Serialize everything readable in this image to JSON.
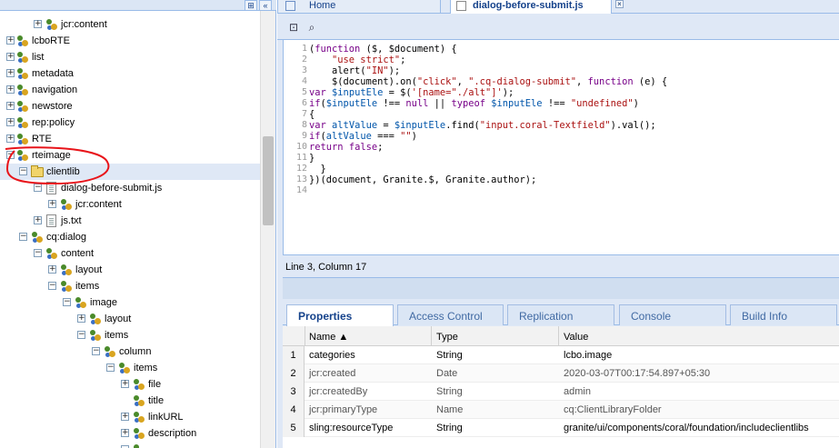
{
  "tree": {
    "nodes": [
      {
        "label": "jcr:content",
        "icon": "node-icon",
        "expander": "+"
      },
      {
        "label": "lcboRTE",
        "icon": "node-icon",
        "expander": "+"
      },
      {
        "label": "list",
        "icon": "node-icon",
        "expander": "+"
      },
      {
        "label": "metadata",
        "icon": "node-icon",
        "expander": "+"
      },
      {
        "label": "navigation",
        "icon": "node-icon",
        "expander": "+"
      },
      {
        "label": "newstore",
        "icon": "node-icon",
        "expander": "+"
      },
      {
        "label": "rep:policy",
        "icon": "node-icon",
        "expander": "+"
      },
      {
        "label": "RTE",
        "icon": "node-icon",
        "expander": "+"
      },
      {
        "label": "rteimage",
        "icon": "node-icon",
        "expander": "−"
      },
      {
        "label": "clientlib",
        "icon": "folder-icon",
        "expander": "−",
        "selected": true
      },
      {
        "label": "dialog-before-submit.js",
        "icon": "file-icon",
        "expander": "−"
      },
      {
        "label": "jcr:content",
        "icon": "node-icon",
        "expander": "+"
      },
      {
        "label": "js.txt",
        "icon": "file-icon",
        "expander": "+"
      },
      {
        "label": "cq:dialog",
        "icon": "node-icon",
        "expander": "−"
      },
      {
        "label": "content",
        "icon": "node-icon",
        "expander": "−"
      },
      {
        "label": "layout",
        "icon": "node-icon",
        "expander": "+"
      },
      {
        "label": "items",
        "icon": "node-icon",
        "expander": "−"
      },
      {
        "label": "image",
        "icon": "node-icon",
        "expander": "−"
      },
      {
        "label": "layout",
        "icon": "node-icon",
        "expander": "+"
      },
      {
        "label": "items",
        "icon": "node-icon",
        "expander": "−"
      },
      {
        "label": "column",
        "icon": "node-icon",
        "expander": "−"
      },
      {
        "label": "items",
        "icon": "node-icon",
        "expander": "−"
      },
      {
        "label": "file",
        "icon": "node-icon",
        "expander": "+"
      },
      {
        "label": "title",
        "icon": "node-icon",
        "expander": ""
      },
      {
        "label": "linkURL",
        "icon": "node-icon",
        "expander": "+"
      },
      {
        "label": "description",
        "icon": "node-icon",
        "expander": "+"
      }
    ]
  },
  "editor_tabs": {
    "home": "Home",
    "active": "dialog-before-submit.js",
    "close": "×"
  },
  "code": {
    "line_numbers": [
      "1",
      "2",
      "3",
      "4",
      "5",
      "6",
      "7",
      "8",
      "9",
      "10",
      "11",
      "12",
      "13",
      "14"
    ]
  },
  "status": {
    "position": "Line 3, Column 17"
  },
  "properties": {
    "tabs": [
      "Properties",
      "Access Control",
      "Replication",
      "Console",
      "Build Info"
    ],
    "columns": {
      "name": "Name ▲",
      "type": "Type",
      "value": "Value"
    },
    "rows": [
      {
        "n": "1",
        "name": "categories",
        "type": "String",
        "value": "lcbo.image",
        "muted": false
      },
      {
        "n": "2",
        "name": "jcr:created",
        "type": "Date",
        "value": "2020-03-07T00:17:54.897+05:30",
        "muted": true
      },
      {
        "n": "3",
        "name": "jcr:createdBy",
        "type": "String",
        "value": "admin",
        "muted": true
      },
      {
        "n": "4",
        "name": "jcr:primaryType",
        "type": "Name",
        "value": "cq:ClientLibraryFolder",
        "muted": true
      },
      {
        "n": "5",
        "name": "sling:resourceType",
        "type": "String",
        "value": "granite/ui/components/coral/foundation/includeclientlibs",
        "muted": false
      }
    ]
  },
  "colors": {
    "panel_bg": "#dfe8f6",
    "border": "#99bbe8",
    "selection": "#dfe8f6",
    "annotation": "#e8141a"
  }
}
